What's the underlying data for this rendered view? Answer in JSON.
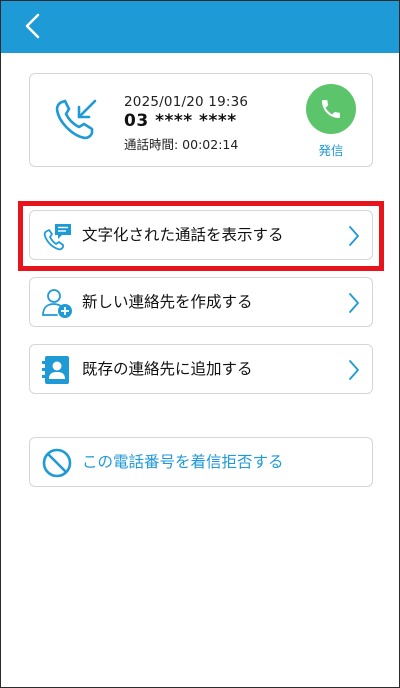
{
  "header": {
    "background": "#1e9ad6",
    "back_icon": "chevron-left-icon"
  },
  "call": {
    "icon": "incoming-call-icon",
    "datetime": "2025/01/20 19:36",
    "number": "03 **** ****",
    "duration": "通話時間: 00:02:14",
    "dial_label": "発信",
    "dial_color": "#5cc46a"
  },
  "actions": [
    {
      "label": "文字化された通話を表示する",
      "icon": "transcript-call-icon"
    },
    {
      "label": "新しい連絡先を作成する",
      "icon": "add-contact-icon"
    },
    {
      "label": "既存の連絡先に追加する",
      "icon": "contact-card-icon"
    }
  ],
  "block": {
    "label": "この電話番号を着信拒否する",
    "icon": "block-icon"
  },
  "colors": {
    "accent": "#1e9ad6",
    "highlight": "#e8141b"
  }
}
